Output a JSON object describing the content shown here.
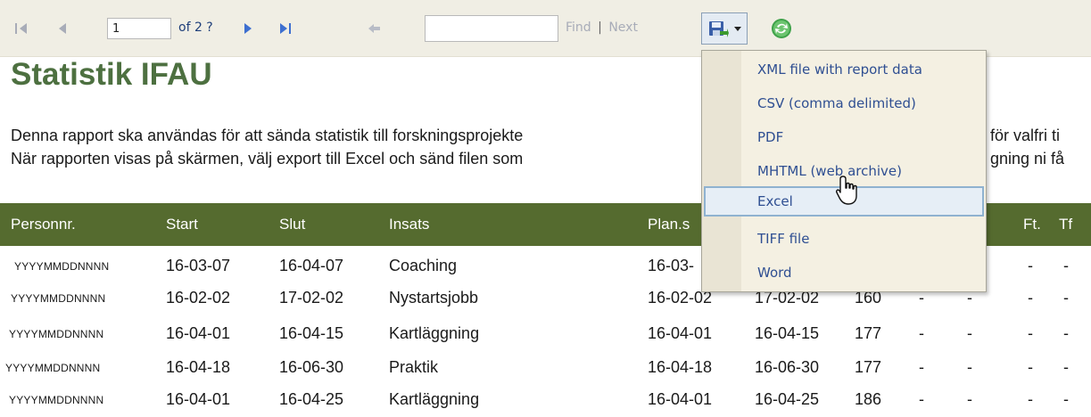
{
  "toolbar": {
    "page_value": "1",
    "page_of": "of 2 ?",
    "find_value": "",
    "find_label": "Find",
    "separator": "|",
    "next_label": "Next"
  },
  "report": {
    "title": "Statistik IFAU",
    "description_line1": "Denna rapport ska användas för att sända statistik till forskningsprojekte",
    "description_line1_tail": "för valfri ti",
    "description_line2": "När rapporten visas på skärmen, välj export till Excel och sänd filen som",
    "description_line2_tail": "gning ni få"
  },
  "table": {
    "columns": [
      "Personnr.",
      "Start",
      "Slut",
      "Insats",
      "Plan.s",
      "Ft.",
      "Tf"
    ],
    "rows": [
      [
        "YYYYMMDDNNNN",
        "16-03-07",
        "16-04-07",
        "Coaching",
        "16-03-",
        "",
        "",
        "",
        "",
        "-",
        "-"
      ],
      [
        "YYYYMMDDNNNN",
        "16-02-02",
        "17-02-02",
        "Nystartsjobb",
        "16-02-02",
        "17-02-02",
        "160",
        "-",
        "-",
        "-",
        "-"
      ],
      [
        "YYYYMMDDNNNN",
        "16-04-01",
        "16-04-15",
        "Kartläggning",
        "16-04-01",
        "16-04-15",
        "177",
        "-",
        "-",
        "-",
        "-"
      ],
      [
        "YYYYMMDDNNNN",
        "16-04-18",
        "16-06-30",
        "Praktik",
        "16-04-18",
        "16-06-30",
        "177",
        "-",
        "-",
        "-",
        "-"
      ],
      [
        "YYYYMMDDNNNN",
        "16-04-01",
        "16-04-25",
        "Kartläggning",
        "16-04-01",
        "16-04-25",
        "186",
        "-",
        "-",
        "-",
        "-"
      ]
    ]
  },
  "export_menu": {
    "items": [
      "XML file with report data",
      "CSV (comma delimited)",
      "PDF",
      "MHTML (web archive)",
      "Excel",
      "TIFF file",
      "Word"
    ],
    "hovered": "Excel"
  },
  "icons": {
    "first_page": "first-page-icon",
    "prev_page": "previous-page-icon",
    "next_page": "next-page-icon",
    "last_page": "last-page-icon",
    "back": "back-to-parent-icon",
    "export": "save-disk-icon",
    "refresh": "refresh-icon",
    "cursor": "hand-pointer-icon"
  },
  "colors": {
    "title": "#4d7040",
    "header_bg": "#556b2f",
    "link": "#2f4f92",
    "toolbar_bg": "#f0eee4"
  }
}
